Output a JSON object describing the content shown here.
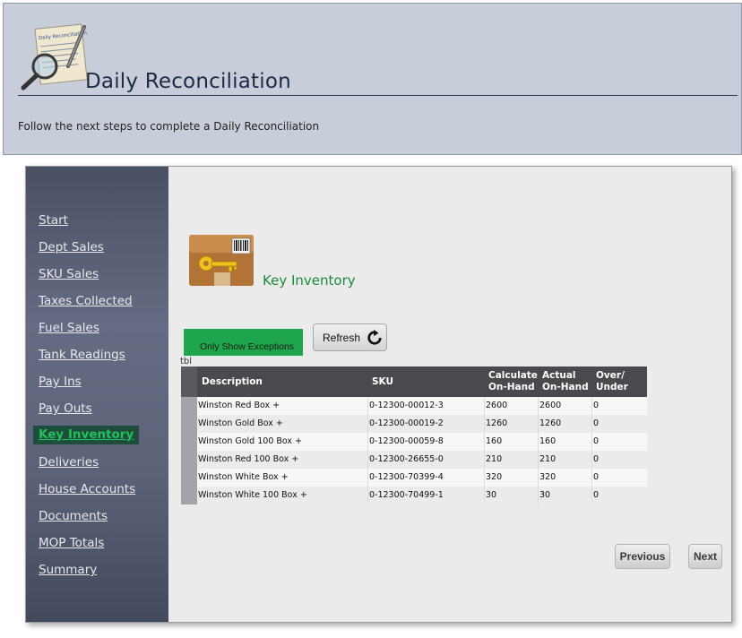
{
  "header": {
    "title": "Daily Reconciliation",
    "subtitle": "Follow the next steps to complete a Daily Reconciliation",
    "logo_icon": "clipboard-magnifier-icon",
    "logo_doc_text": "Daily Reconciliation"
  },
  "sidebar": {
    "items": [
      {
        "label": "Start",
        "active": false
      },
      {
        "label": "Dept Sales",
        "active": false
      },
      {
        "label": "SKU Sales",
        "active": false
      },
      {
        "label": "Taxes Collected",
        "active": false
      },
      {
        "label": "Fuel Sales",
        "active": false
      },
      {
        "label": "Tank Readings",
        "active": false
      },
      {
        "label": "Pay Ins",
        "active": false
      },
      {
        "label": "Pay Outs",
        "active": false
      },
      {
        "label": "Key Inventory",
        "active": true
      },
      {
        "label": "Deliveries",
        "active": false
      },
      {
        "label": "House Accounts",
        "active": false
      },
      {
        "label": "Documents",
        "active": false
      },
      {
        "label": "MOP Totals",
        "active": false
      },
      {
        "label": "Summary",
        "active": false
      }
    ]
  },
  "section": {
    "title": "Key Inventory",
    "icon": "key-barcode-icon"
  },
  "toolbar": {
    "exceptions_label": "Only Show Exceptions",
    "refresh_label": "Refresh"
  },
  "table": {
    "label": "tbl",
    "headers": {
      "description": "Description",
      "sku": "SKU",
      "calc_1": "Calculate",
      "calc_2": "On-Hand",
      "actual_1": "Actual",
      "actual_2": "On-Hand",
      "over_1": "Over/",
      "over_2": "Under"
    },
    "rows": [
      {
        "description": "Winston Red Box +",
        "sku": "0-12300-00012-3",
        "calc": "2600",
        "actual": "2600",
        "over": "0"
      },
      {
        "description": "Winston Gold Box +",
        "sku": "0-12300-00019-2",
        "calc": "1260",
        "actual": "1260",
        "over": "0"
      },
      {
        "description": "Winston Gold 100 Box +",
        "sku": "0-12300-00059-8",
        "calc": "160",
        "actual": "160",
        "over": "0"
      },
      {
        "description": "Winston Red 100 Box +",
        "sku": "0-12300-26655-0",
        "calc": "210",
        "actual": "210",
        "over": "0"
      },
      {
        "description": "Winston White Box +",
        "sku": "0-12300-70399-4",
        "calc": "320",
        "actual": "320",
        "over": "0"
      },
      {
        "description": "Winston White 100 Box +",
        "sku": "0-12300-70499-1",
        "calc": "30",
        "actual": "30",
        "over": "0"
      }
    ]
  },
  "footer": {
    "previous_label": "Previous",
    "next_label": "Next"
  },
  "colors": {
    "header_bg": "#c8cdda",
    "sidebar_bg": "#5d6379",
    "active_nav_bg": "#1f4d3b",
    "active_nav_text": "#22c05a",
    "accent_green": "#1fa54b",
    "section_title": "#1b8a3c",
    "table_header_bg": "#4a4a4e"
  }
}
